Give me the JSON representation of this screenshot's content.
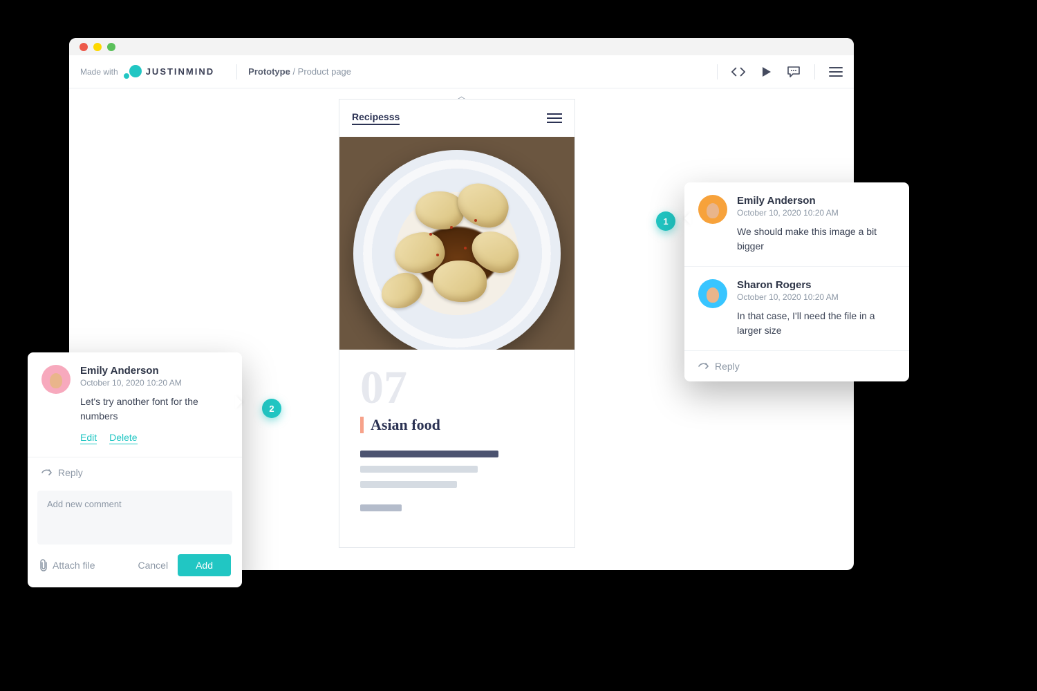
{
  "header": {
    "made_with": "Made with",
    "brand": "JUSTINMIND",
    "crumb_root": "Prototype",
    "crumb_sep": " / ",
    "crumb_page": "Product page"
  },
  "phone": {
    "brand": "Recipesss",
    "number": "07",
    "dish": "Asian food"
  },
  "pins": {
    "p1": "1",
    "p2": "2"
  },
  "pop_right": {
    "c1_name": "Emily Anderson",
    "c1_date": "October 10, 2020 10:20 AM",
    "c1_text": "We should make this image a bit bigger",
    "c2_name": "Sharon Rogers",
    "c2_date": "October 10, 2020 10:20 AM",
    "c2_text": "In that case, I'll need the file in a larger size",
    "reply": "Reply"
  },
  "pop_left": {
    "name": "Emily Anderson",
    "date": "October 10, 2020 10:20 AM",
    "text": "Let's try another font for the numbers",
    "edit": "Edit",
    "delete": "Delete",
    "reply": "Reply",
    "placeholder": "Add new comment",
    "attach": "Attach file",
    "cancel": "Cancel",
    "add": "Add"
  }
}
